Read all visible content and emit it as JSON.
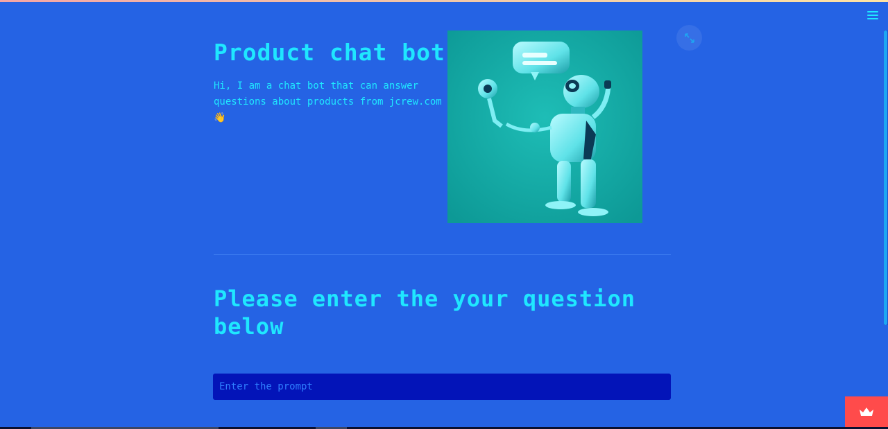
{
  "header": {
    "title": "Product chat bot",
    "intro": "Hi, I am a chat bot that can answer questions about products from jcrew.com 👋"
  },
  "main": {
    "question_heading": "Please enter the your question below",
    "prompt_placeholder": "Enter the prompt",
    "prompt_value": ""
  },
  "icons": {
    "menu": "hamburger-menu-icon",
    "expand": "fullscreen-expand-icon",
    "badge": "crown-icon"
  },
  "colors": {
    "background": "#2563e4",
    "accent_text": "#1fe7ff",
    "input_bg": "#0314b8",
    "badge": "#ff4b4b"
  }
}
